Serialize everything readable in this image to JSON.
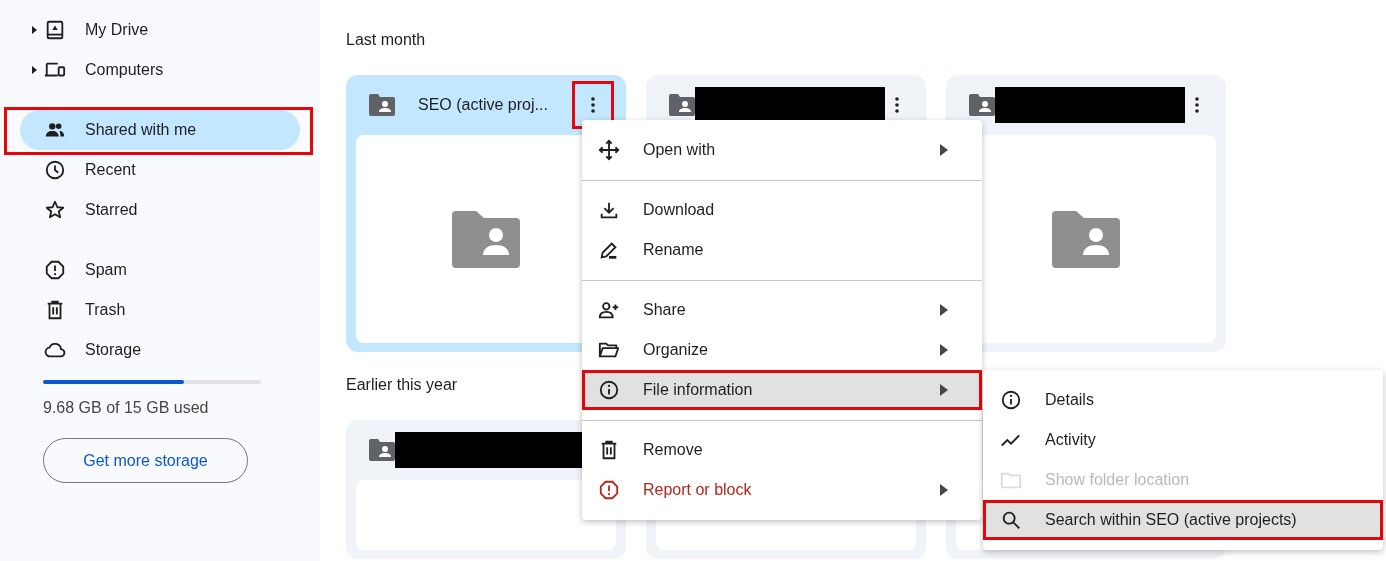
{
  "sidebar": {
    "groups": [
      {
        "items": [
          {
            "label": "My Drive",
            "expandable": true,
            "selected": false,
            "framed": false
          },
          {
            "label": "Computers",
            "expandable": true,
            "selected": false,
            "framed": false
          }
        ]
      },
      {
        "items": [
          {
            "label": "Shared with me",
            "expandable": false,
            "selected": true,
            "framed": true
          },
          {
            "label": "Recent",
            "expandable": false,
            "selected": false,
            "framed": false
          },
          {
            "label": "Starred",
            "expandable": false,
            "selected": false,
            "framed": false
          }
        ]
      },
      {
        "items": [
          {
            "label": "Spam",
            "expandable": false,
            "selected": false,
            "framed": false
          },
          {
            "label": "Trash",
            "expandable": false,
            "selected": false,
            "framed": false
          },
          {
            "label": "Storage",
            "expandable": false,
            "selected": false,
            "framed": false
          }
        ]
      }
    ],
    "storage": {
      "level": 0.645,
      "usage": "9.68 GB of 15 GB used",
      "button": "Get more storage"
    }
  },
  "sections": [
    {
      "heading": "Last month",
      "cards": [
        {
          "title": "SEO (active proj...",
          "selected": true,
          "redacted": false,
          "menu_framed": true
        },
        {
          "selected": false,
          "redacted": true,
          "menu_framed": false
        },
        {
          "selected": false,
          "redacted": true,
          "menu_framed": false
        }
      ]
    },
    {
      "heading": "Earlier this year",
      "cards": [
        {
          "selected": false,
          "redacted": true
        },
        {
          "selected": false
        },
        {
          "selected": false
        }
      ]
    }
  ],
  "context_menu": {
    "groups": [
      {
        "items": [
          {
            "label": "Open with",
            "kind": "normal",
            "submenu": true,
            "highlighted": false,
            "framed": false
          }
        ]
      },
      {
        "items": [
          {
            "label": "Download",
            "kind": "normal",
            "submenu": false,
            "highlighted": false,
            "framed": false
          },
          {
            "label": "Rename",
            "kind": "normal",
            "submenu": false,
            "highlighted": false,
            "framed": false
          }
        ]
      },
      {
        "items": [
          {
            "label": "Share",
            "kind": "normal",
            "submenu": true,
            "highlighted": false,
            "framed": false
          },
          {
            "label": "Organize",
            "kind": "normal",
            "submenu": true,
            "highlighted": false,
            "framed": false
          },
          {
            "label": "File information",
            "kind": "normal",
            "submenu": true,
            "highlighted": true,
            "framed": true
          }
        ]
      },
      {
        "items": [
          {
            "label": "Remove",
            "kind": "normal",
            "submenu": false,
            "highlighted": false,
            "framed": false
          },
          {
            "label": "Report or block",
            "kind": "danger",
            "submenu": true,
            "highlighted": false,
            "framed": false
          }
        ]
      }
    ]
  },
  "submenu": {
    "items": [
      {
        "label": "Details",
        "disabled": false,
        "highlighted": false,
        "framed": false
      },
      {
        "label": "Activity",
        "disabled": false,
        "highlighted": false,
        "framed": false
      },
      {
        "label": "Show folder location",
        "disabled": true,
        "highlighted": false,
        "framed": false
      },
      {
        "label": "Search within SEO (active projects)",
        "disabled": false,
        "highlighted": true,
        "framed": true
      }
    ]
  }
}
